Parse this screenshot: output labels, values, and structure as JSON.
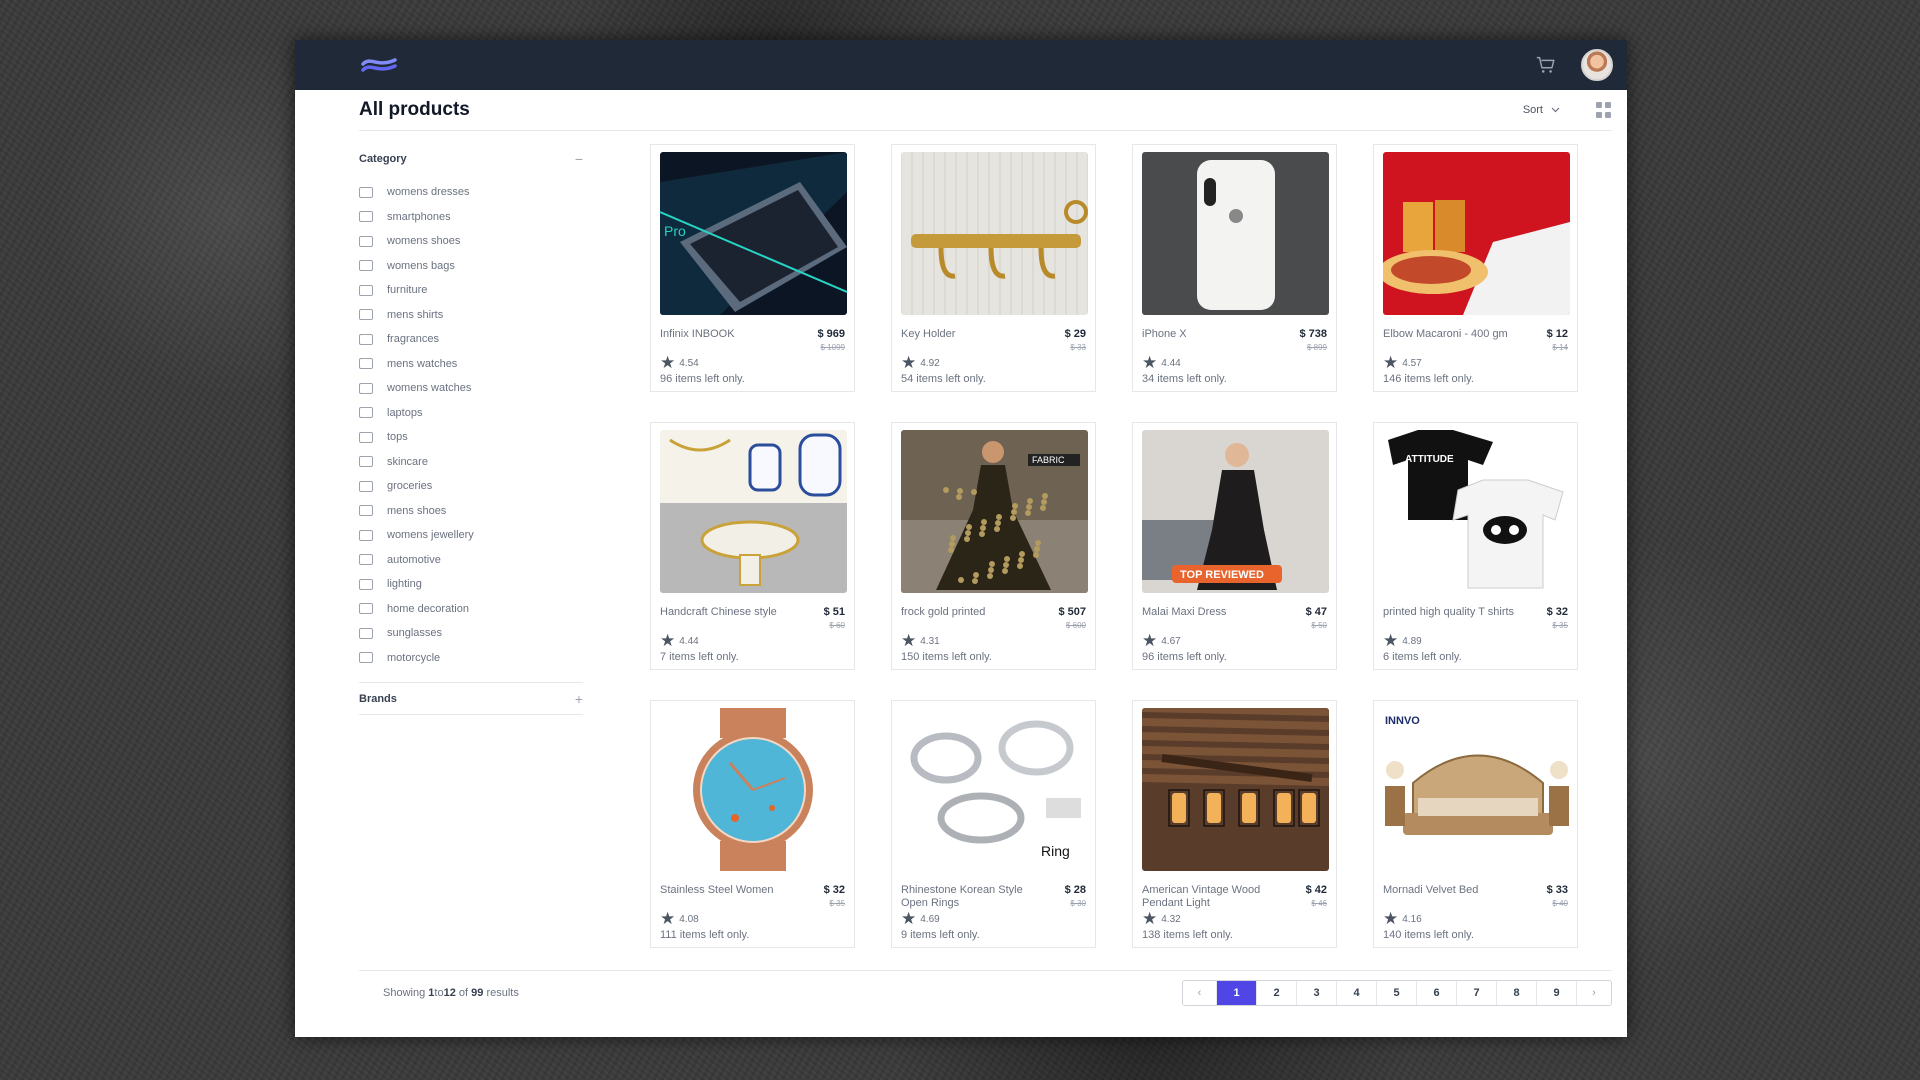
{
  "header": {
    "title": "All products",
    "sort_label": "Sort"
  },
  "filters": {
    "category_title": "Category",
    "category_toggle": "−",
    "categories": [
      "womens dresses",
      "smartphones",
      "womens shoes",
      "womens bags",
      "furniture",
      "mens shirts",
      "fragrances",
      "mens watches",
      "womens watches",
      "laptops",
      "tops",
      "skincare",
      "groceries",
      "mens shoes",
      "womens jewellery",
      "automotive",
      "lighting",
      "home decoration",
      "sunglasses",
      "motorcycle"
    ],
    "brands_title": "Brands",
    "brands_toggle": "+"
  },
  "products": [
    {
      "name": "Infinix INBOOK",
      "price": "$ 969",
      "old_price": "$ 1099",
      "rating": "4.54",
      "stock": "96 items left only."
    },
    {
      "name": "Key Holder",
      "price": "$ 29",
      "old_price": "$ 33",
      "rating": "4.92",
      "stock": "54 items left only."
    },
    {
      "name": "iPhone X",
      "price": "$ 738",
      "old_price": "$ 899",
      "rating": "4.44",
      "stock": "34 items left only."
    },
    {
      "name": "Elbow Macaroni - 400 gm",
      "price": "$ 12",
      "old_price": "$ 14",
      "rating": "4.57",
      "stock": "146 items left only."
    },
    {
      "name": "Handcraft Chinese style",
      "price": "$ 51",
      "old_price": "$ 60",
      "rating": "4.44",
      "stock": "7 items left only."
    },
    {
      "name": "frock gold printed",
      "price": "$ 507",
      "old_price": "$ 600",
      "rating": "4.31",
      "stock": "150 items left only."
    },
    {
      "name": "Malai Maxi Dress",
      "price": "$ 47",
      "old_price": "$ 50",
      "rating": "4.67",
      "stock": "96 items left only."
    },
    {
      "name": "printed high quality T shirts",
      "price": "$ 32",
      "old_price": "$ 35",
      "rating": "4.89",
      "stock": "6 items left only."
    },
    {
      "name": "Stainless Steel Women",
      "price": "$ 32",
      "old_price": "$ 35",
      "rating": "4.08",
      "stock": "111 items left only."
    },
    {
      "name": "Rhinestone Korean Style Open Rings",
      "price": "$ 28",
      "old_price": "$ 30",
      "rating": "4.69",
      "stock": "9 items left only."
    },
    {
      "name": "American Vintage Wood Pendant Light",
      "price": "$ 42",
      "old_price": "$ 46",
      "rating": "4.32",
      "stock": "138 items left only."
    },
    {
      "name": "Mornadi Velvet Bed",
      "price": "$ 33",
      "old_price": "$ 40",
      "rating": "4.16",
      "stock": "140 items left only."
    }
  ],
  "thumb_texts": {
    "laptop": "Pro",
    "dress": "FABRIC",
    "badge": "TOP REVIEWED",
    "tshirt": "ATTITUDE",
    "ring": "Ring",
    "bed": "INNVO"
  },
  "footer": {
    "showing_prefix": "Showing",
    "range_start": "1",
    "range_mid": "to",
    "range_end": "12",
    "of": "of",
    "total": "99",
    "results": "results"
  },
  "pagination": {
    "prev": "‹",
    "next": "›",
    "pages": [
      "1",
      "2",
      "3",
      "4",
      "5",
      "6",
      "7",
      "8",
      "9"
    ],
    "current": "1"
  },
  "colors": {
    "topbar": "#1f2937",
    "accent": "#4f46e5"
  },
  "icons": {
    "logo": "wave-logo-icon",
    "cart": "cart-icon",
    "sort": "chevron-down-icon",
    "view": "grid-view-icon",
    "rating": "star-icon"
  }
}
